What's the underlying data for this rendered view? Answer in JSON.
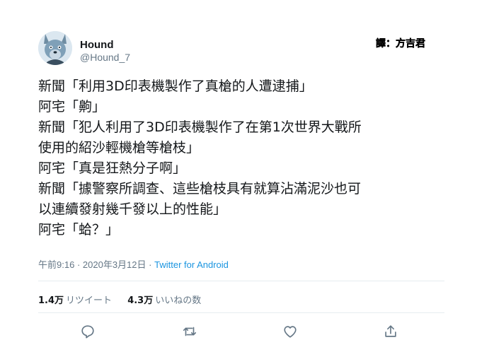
{
  "user": {
    "display_name": "Hound",
    "handle": "@Hound_7"
  },
  "translator_mark": "譯：方吉君",
  "tweet": {
    "lines": [
      "新聞「利用3D印表機製作了真槍的人遭逮捕」",
      "阿宅「齁」",
      "新聞「犯人利用了3D印表機製作了在第1次世界大戰所",
      "使用的紹沙輕機槍等槍枝」",
      "阿宅「真是狂熱分子啊」",
      "新聞「據警察所調查、這些槍枝具有就算沾滿泥沙也可",
      "以連續發射幾千發以上的性能」",
      "阿宅「蛤？」"
    ]
  },
  "meta": {
    "time": "午前9:16",
    "separator": "·",
    "date": "2020年3月12日",
    "source": "Twitter for Android"
  },
  "stats": {
    "retweets_count": "1.4万",
    "retweets_label": "リツイート",
    "likes_count": "4.3万",
    "likes_label": "いいねの数"
  },
  "actions": {
    "icons": [
      "reply-icon",
      "retweet-icon",
      "like-icon",
      "share-icon"
    ],
    "icon_color": "#657786"
  },
  "colors": {
    "text": "#14171a",
    "secondary": "#657786",
    "link": "#1b95e0",
    "divider": "#e6ecf0"
  }
}
